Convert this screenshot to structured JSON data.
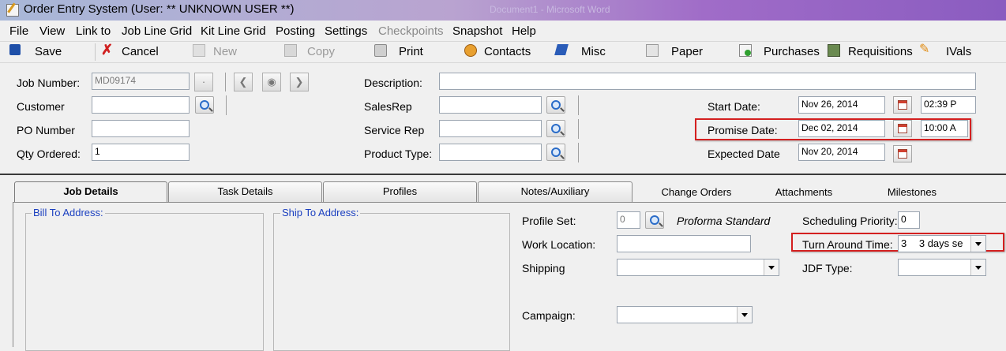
{
  "window": {
    "title": "Order Entry System  (User: ** UNKNOWN USER **)",
    "background_title": "Document1 - Microsoft Word"
  },
  "menu": [
    "File",
    "View",
    "Link to",
    "Job Line Grid",
    "Kit Line Grid",
    "Posting",
    "Settings",
    "Checkpoints",
    "Snapshot",
    "Help"
  ],
  "toolbar": {
    "save": "Save",
    "cancel": "Cancel",
    "new": "New",
    "copy": "Copy",
    "print": "Print",
    "contacts": "Contacts",
    "misc": "Misc",
    "paper": "Paper",
    "purchases": "Purchases",
    "requisitions": "Requisitions",
    "ivals": "IVals"
  },
  "header": {
    "job_number_label": "Job Number:",
    "job_number": "MD09174",
    "customer_label": "Customer",
    "customer": "",
    "po_number_label": "PO Number",
    "po_number": "",
    "qty_ordered_label": "Qty Ordered:",
    "qty_ordered": "1",
    "description_label": "Description:",
    "description": "",
    "salesrep_label": "SalesRep",
    "salesrep": "",
    "service_rep_label": "Service Rep",
    "service_rep": "",
    "product_type_label": "Product Type:",
    "product_type": "",
    "start_date_label": "Start Date:",
    "start_date": "Nov 26, 2014",
    "start_time": "02:39 P",
    "promise_date_label": "Promise Date:",
    "promise_date": "Dec 02, 2014",
    "promise_time": "10:00 A",
    "expected_date_label": "Expected Date",
    "expected_date": "Nov 20, 2014"
  },
  "tabs": [
    "Job Details",
    "Task Details",
    "Profiles",
    "Notes/Auxiliary",
    "Change Orders",
    "Attachments",
    "Milestones"
  ],
  "details": {
    "bill_to_label": "Bill To Address:",
    "ship_to_label": "Ship To Address:",
    "profile_set_label": "Profile Set:",
    "profile_set": "0",
    "profile_set_name": "Proforma Standard",
    "work_location_label": "Work Location:",
    "work_location": "",
    "shipping_label": "Shipping",
    "shipping": "",
    "campaign_label": "Campaign:",
    "campaign": "",
    "scheduling_priority_label": "Scheduling Priority:",
    "scheduling_priority": "0",
    "turn_around_label": "Turn Around Time:",
    "turn_around_value": "3",
    "turn_around_text": "3 days se",
    "jdf_type_label": "JDF Type:",
    "jdf_type": ""
  },
  "colors": {
    "highlight_box": "#d42020",
    "group_label": "#1a3fc0"
  }
}
